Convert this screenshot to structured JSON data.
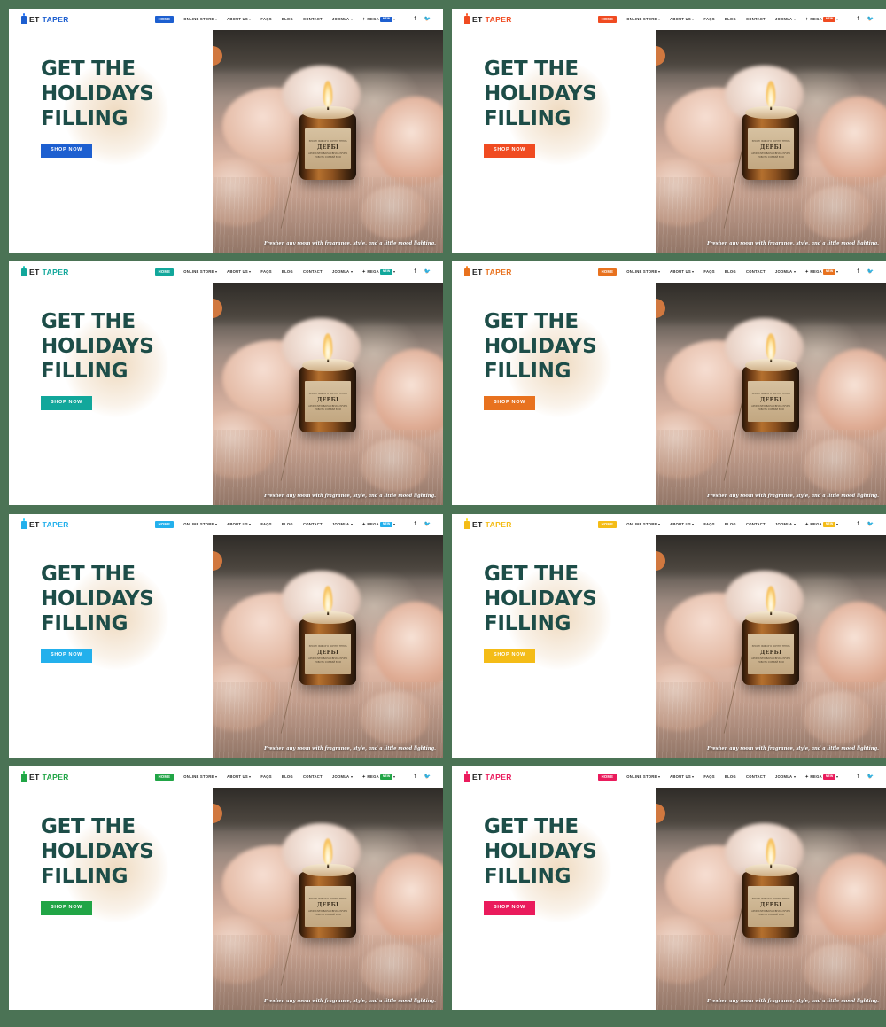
{
  "page": {
    "background_color": "#4b7355",
    "variant_count": 8
  },
  "logo": {
    "prefix": "ET",
    "suffix": "TAPER",
    "icon": "candle-icon"
  },
  "nav": {
    "items": [
      {
        "label": "HOME",
        "active": true,
        "caret": false
      },
      {
        "label": "ONLINE STORE",
        "active": false,
        "caret": true
      },
      {
        "label": "ABOUT US",
        "active": false,
        "caret": true
      },
      {
        "label": "FAQS",
        "active": false,
        "caret": false
      },
      {
        "label": "BLOG",
        "active": false,
        "caret": false
      },
      {
        "label": "CONTACT",
        "active": false,
        "caret": false
      },
      {
        "label": "JOOMLA",
        "active": false,
        "caret": true
      },
      {
        "label": "MEGA",
        "active": false,
        "caret": true,
        "badge": "NEW",
        "star": true
      }
    ],
    "socials": [
      {
        "name": "facebook-icon",
        "glyph": "f"
      },
      {
        "name": "twitter-icon",
        "glyph": "🐦"
      }
    ]
  },
  "hero": {
    "headline_line1": "GET THE",
    "headline_line2": "HOLIDAYS",
    "headline_line3": "FILLING",
    "headline_color": "#1d4d48",
    "cta_label": "SHOP NOW",
    "tagline": "Freshen any room with fragrance, style, and a little mood lighting.",
    "product": {
      "label_top": "ЗРОСТІ ЖИВОГО ВОГНЮ ТЕПЛА",
      "label_name": "ДЕРБІ",
      "label_bottom": "АРОМАТИЗОВАНА СВІЧКА РУЧНА РОБОТА СОЄВИЙ ВІСК"
    },
    "dot_color": "#d1783f"
  },
  "variants": [
    {
      "id": 1,
      "name": "blue",
      "accent": "#1d5fd0",
      "badge": "#1d5fd0"
    },
    {
      "id": 2,
      "name": "orange-red",
      "accent": "#f04b21",
      "badge": "#f04b21"
    },
    {
      "id": 3,
      "name": "teal",
      "accent": "#12a79b",
      "badge": "#12a79b"
    },
    {
      "id": 4,
      "name": "orange",
      "accent": "#e8721f",
      "badge": "#e8721f"
    },
    {
      "id": 5,
      "name": "sky-blue",
      "accent": "#23b0ec",
      "badge": "#23b0ec"
    },
    {
      "id": 6,
      "name": "yellow",
      "accent": "#f4bc17",
      "badge": "#f4bc17"
    },
    {
      "id": 7,
      "name": "green",
      "accent": "#21a546",
      "badge": "#21a546"
    },
    {
      "id": 8,
      "name": "pink",
      "accent": "#ea1b5c",
      "badge": "#ea1b5c"
    }
  ]
}
